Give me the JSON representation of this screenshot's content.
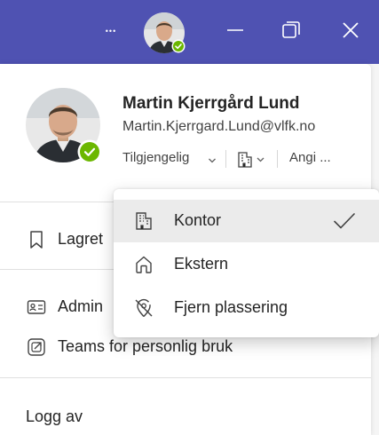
{
  "titlebar": {
    "more_glyph": "•••",
    "accent": "#4f52b2",
    "icons": [
      "more-icon",
      "avatar",
      "minimize-icon",
      "restore-icon",
      "close-icon"
    ]
  },
  "profile": {
    "name": "Martin Kjerrgård Lund",
    "email": "Martin.Kjerrgard.Lund@vlfk.no",
    "status": "Tilgjengelig",
    "status_color": "#6bb700",
    "message_label": "Angi ..."
  },
  "menu_items": [
    {
      "label": "Lagret"
    },
    {
      "label": "Admin"
    },
    {
      "label": "Teams for personlig bruk"
    },
    {
      "label": "Logg av"
    }
  ],
  "location_menu": {
    "items": [
      {
        "label": "Kontor",
        "icon": "building-icon",
        "selected": true
      },
      {
        "label": "Ekstern",
        "icon": "home-icon"
      },
      {
        "label": "Fjern plassering",
        "icon": "location-off-icon"
      }
    ]
  }
}
